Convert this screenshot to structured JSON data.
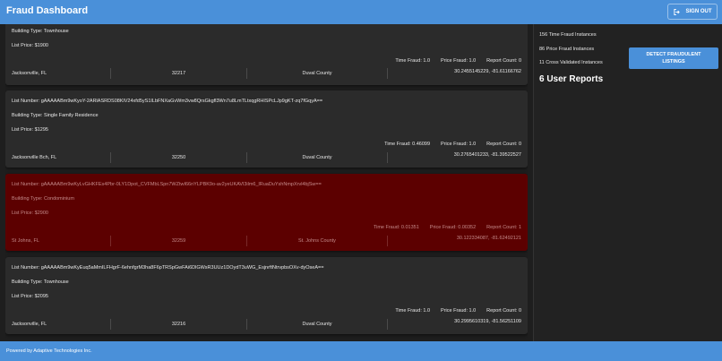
{
  "app": {
    "title": "Fraud Dashboard",
    "signout_label": "SIGN OUT"
  },
  "listings": [
    {
      "list_number": "",
      "building_type": "Building Type: Townhouse",
      "list_price": "List Price: $1900",
      "time_fraud": "Time Fraud: 1.0",
      "price_fraud": "Price Fraud: 1.0",
      "report_count": "Report Count: 0",
      "coords": "30.2455145229, -81.61166762",
      "city": "Jacksonville, FL",
      "zip": "32217",
      "county": "Duval County",
      "flagged": false
    },
    {
      "list_number": "List Number: gAAAAABm9wKyoY-2ARlASRDS08KlV24xfd5yS1ILbFNXaGvWm3vw8QrsGkgfl3Wn7u8LmTLtxqgRHISPcLJp9gKT-zq7fGqyA==",
      "building_type": "Building Type: Single Family Residence",
      "list_price": "List Price: $1295",
      "time_fraud": "Time Fraud: 0.46099",
      "price_fraud": "Price Fraud: 1.0",
      "report_count": "Report Count: 0",
      "coords": "30.2765401233, -81.39522527",
      "city": "Jacksonville Bch, FL",
      "zip": "32250",
      "county": "Duval County",
      "flagged": false
    },
    {
      "list_number": "List Number: gAAAAABm9wKyLvGHKFEs4Pbr-0LY1Dpot_CVFMbLSpn7WZtwI66nYLPBK9o-av2yeUKAVl3ilm6_lRuaDuYshNmpXrvl4bjSw==",
      "building_type": "Building Type: Condominium",
      "list_price": "List Price: $2900",
      "time_fraud": "Time Fraud: 0.01351",
      "price_fraud": "Price Fraud: 0.00352",
      "report_count": "Report Count: 1",
      "coords": "30.122334087, -81.62492121",
      "city": "St Johns, FL",
      "zip": "32259",
      "county": "St. Johns County",
      "flagged": true
    },
    {
      "list_number": "List Number: gAAAAABm9wKyEuq5aMmILFHgrF-6ehnfgrM3ha8F6pTRSpGwFAi6DlGWsR3UUz1DOydT3uWG_EsjnrftNtrvpbsOXv-dyOseA==",
      "building_type": "Building Type: Townhouse",
      "list_price": "List Price: $2095",
      "time_fraud": "Time Fraud: 1.0",
      "price_fraud": "Price Fraud: 1.0",
      "report_count": "Report Count: 0",
      "coords": "30.2995610319, -81.56251109",
      "city": "Jacksonville, FL",
      "zip": "32216",
      "county": "Duval County",
      "flagged": false
    }
  ],
  "sidebar": {
    "time_fraud_instances": "156 Time Fraud Instances",
    "price_fraud_instances": "86 Price Fraud Instances",
    "cross_validated_instances": "11 Cross Validated Instances",
    "detect_button_label": "DETECT FRAUDULENT LISTINGS",
    "user_reports": "6 User Reports"
  },
  "footer": {
    "text": "Powered by Adaptive Technologies Inc."
  },
  "colors": {
    "primary": "#4a90d9",
    "background": "#1e1e1e",
    "card": "#2b2b2b",
    "flagged_card": "#5c0000"
  }
}
